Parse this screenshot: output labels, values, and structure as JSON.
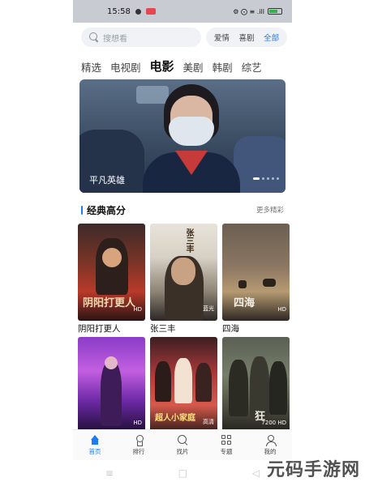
{
  "status_bar": {
    "time": "15:58",
    "right_text": "⚙ ⨀ ≡ .ill",
    "battery": "80"
  },
  "search": {
    "placeholder": "搜想看",
    "quick_tags": [
      "爱情",
      "喜剧",
      "全部"
    ]
  },
  "category_tabs": [
    "精选",
    "电视剧",
    "电影",
    "美剧",
    "韩剧",
    "综艺"
  ],
  "active_category": "电影",
  "banner": {
    "title": "平凡英雄",
    "slide_count": 6,
    "active_slide": 1
  },
  "section": {
    "title": "经典高分",
    "more_label": "更多精彩"
  },
  "movies": [
    {
      "title": "阴阳打更人",
      "badge": "HD",
      "poster_text": "阴阳打更人"
    },
    {
      "title": "张三丰",
      "badge": "蓝光",
      "poster_text": "张三丰"
    },
    {
      "title": "四海",
      "badge": "HD",
      "poster_text": "四海"
    },
    {
      "title": "",
      "badge": "HD",
      "poster_text": ""
    },
    {
      "title": "",
      "badge": "高清",
      "poster_text": "超人小家庭"
    },
    {
      "title": "",
      "badge": "7200 HD",
      "poster_text": "狂"
    }
  ],
  "bottom_nav": [
    {
      "label": "首页",
      "icon": "home-icon",
      "active": true
    },
    {
      "label": "排行",
      "icon": "ranking-icon",
      "active": false
    },
    {
      "label": "找片",
      "icon": "search-icon",
      "active": false
    },
    {
      "label": "专题",
      "icon": "topics-icon",
      "active": false
    },
    {
      "label": "我的",
      "icon": "profile-icon",
      "active": false
    }
  ],
  "system_nav": [
    "≡",
    "□",
    "◁"
  ],
  "watermark": "元码手游网",
  "colors": {
    "accent": "#1e7cf0",
    "status_bar": "#c8ccd2"
  }
}
